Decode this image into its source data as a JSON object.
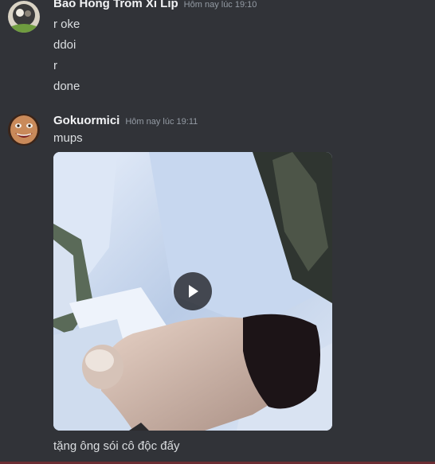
{
  "messages": [
    {
      "username": "Bao Hong Trom Xi Lip",
      "timestamp": "Hôm nay lúc 19:10",
      "lines": [
        "r oke",
        "ddoi",
        "r",
        "done"
      ]
    },
    {
      "username": "Gokuormici",
      "timestamp": "Hôm nay lúc 19:11",
      "lines": [
        "mups"
      ],
      "attachment": {
        "type": "video",
        "icon": "play-icon"
      },
      "caption": "tặng ông sói cô độc đấy"
    }
  ],
  "colors": {
    "background": "#313338",
    "username": "#f2f3f5",
    "timestamp": "#949ba4",
    "text": "#dbdee1"
  }
}
